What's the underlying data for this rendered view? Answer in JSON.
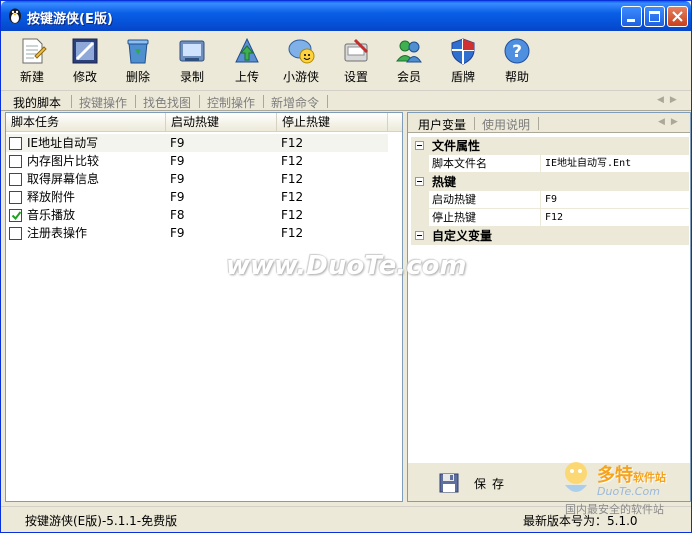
{
  "window": {
    "title": "按键游侠(E版)"
  },
  "toolbar": [
    {
      "label": "新建",
      "icon": "new-document-icon"
    },
    {
      "label": "修改",
      "icon": "edit-icon"
    },
    {
      "label": "删除",
      "icon": "recycle-bin-icon"
    },
    {
      "label": "录制",
      "icon": "record-icon"
    },
    {
      "label": "上传",
      "icon": "upload-icon"
    },
    {
      "label": "小游侠",
      "icon": "chat-smiley-icon"
    },
    {
      "label": "设置",
      "icon": "settings-icon"
    },
    {
      "label": "会员",
      "icon": "members-icon"
    },
    {
      "label": "盾牌",
      "icon": "shield-icon"
    },
    {
      "label": "帮助",
      "icon": "help-icon"
    }
  ],
  "script_tabs": [
    "我的脚本",
    "按键操作",
    "找色找图",
    "控制操作",
    "新增命令"
  ],
  "table": {
    "columns": [
      "脚本任务",
      "启动热键",
      "停止热键"
    ],
    "rows": [
      {
        "task": "IE地址自动写",
        "start": "F9",
        "stop": "F12",
        "checked": false
      },
      {
        "task": "内存图片比较",
        "start": "F9",
        "stop": "F12",
        "checked": false
      },
      {
        "task": "取得屏幕信息",
        "start": "F9",
        "stop": "F12",
        "checked": false
      },
      {
        "task": "释放附件",
        "start": "F9",
        "stop": "F12",
        "checked": false
      },
      {
        "task": "音乐播放",
        "start": "F8",
        "stop": "F12",
        "checked": true
      },
      {
        "task": "注册表操作",
        "start": "F9",
        "stop": "F12",
        "checked": false
      }
    ]
  },
  "right_tabs": [
    "用户变量",
    "使用说明"
  ],
  "property_grid": {
    "file_category": "文件属性",
    "script_file_label": "脚本文件名",
    "script_file_value": "IE地址自动写.Ent",
    "hotkey_category": "热键",
    "start_label": "启动热键",
    "start_value": "F9",
    "stop_label": "停止热键",
    "stop_value": "F12",
    "custom_category": "自定义变量"
  },
  "save_label": "保存",
  "status": {
    "left": "按键游侠(E版)-5.1.1-免费版",
    "right": "最新版本号为：5.1.0"
  },
  "watermark": {
    "center": "www.DuoTe.com",
    "logo_line1": "多特",
    "logo_line1_small": "软件站",
    "logo_line2": "DuoTe.Com",
    "logo_line3": "国内最安全的软件站"
  }
}
